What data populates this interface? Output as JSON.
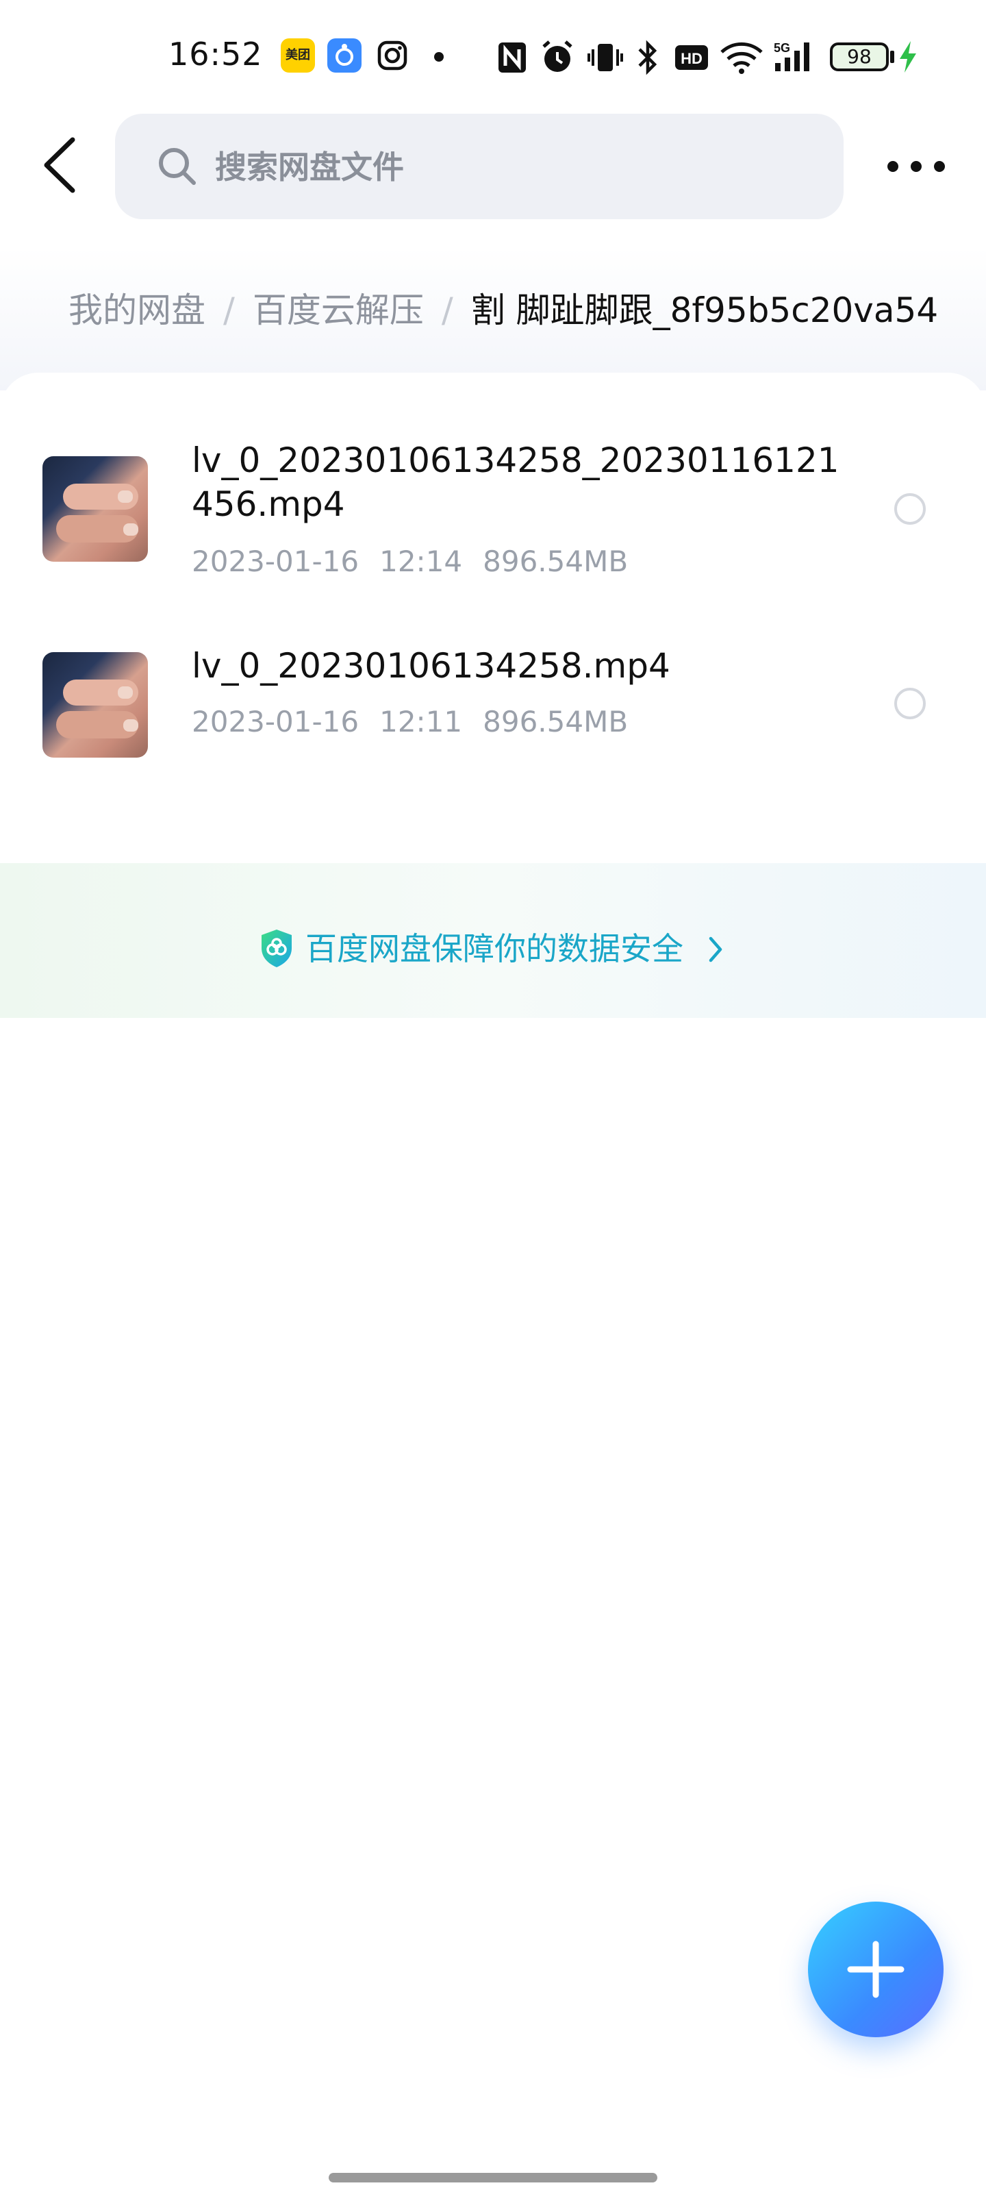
{
  "status_bar": {
    "time": "16:52",
    "meituan_label": "美团",
    "battery_level": "98",
    "icons": [
      "meituan-app-icon",
      "baidu-app-icon",
      "instagram-icon",
      "notification-dot",
      "nfc-icon",
      "alarm-icon",
      "vibrate-icon",
      "bluetooth-icon",
      "hd-icon",
      "wifi-icon",
      "5g-signal-icon",
      "battery-icon",
      "charging-icon"
    ]
  },
  "header": {
    "search_placeholder": "搜索网盘文件"
  },
  "breadcrumb": {
    "items": [
      "我的网盘",
      "百度云解压"
    ],
    "separator": "/",
    "current": "割 脚趾脚跟_8f95b5c20va54"
  },
  "files": [
    {
      "name": "lv_0_20230106134258_20230116121456.mp4",
      "date": "2023-01-16",
      "time": "12:14",
      "size": "896.54MB"
    },
    {
      "name": "lv_0_20230106134258.mp4",
      "date": "2023-01-16",
      "time": "12:11",
      "size": "896.54MB"
    }
  ],
  "security_banner": {
    "text": "百度网盘保障你的数据安全"
  },
  "colors": {
    "accent": "#1aa6c8",
    "fab_start": "#36d0ff",
    "fab_end": "#3a8bff",
    "muted_text": "#9aa0aa"
  }
}
